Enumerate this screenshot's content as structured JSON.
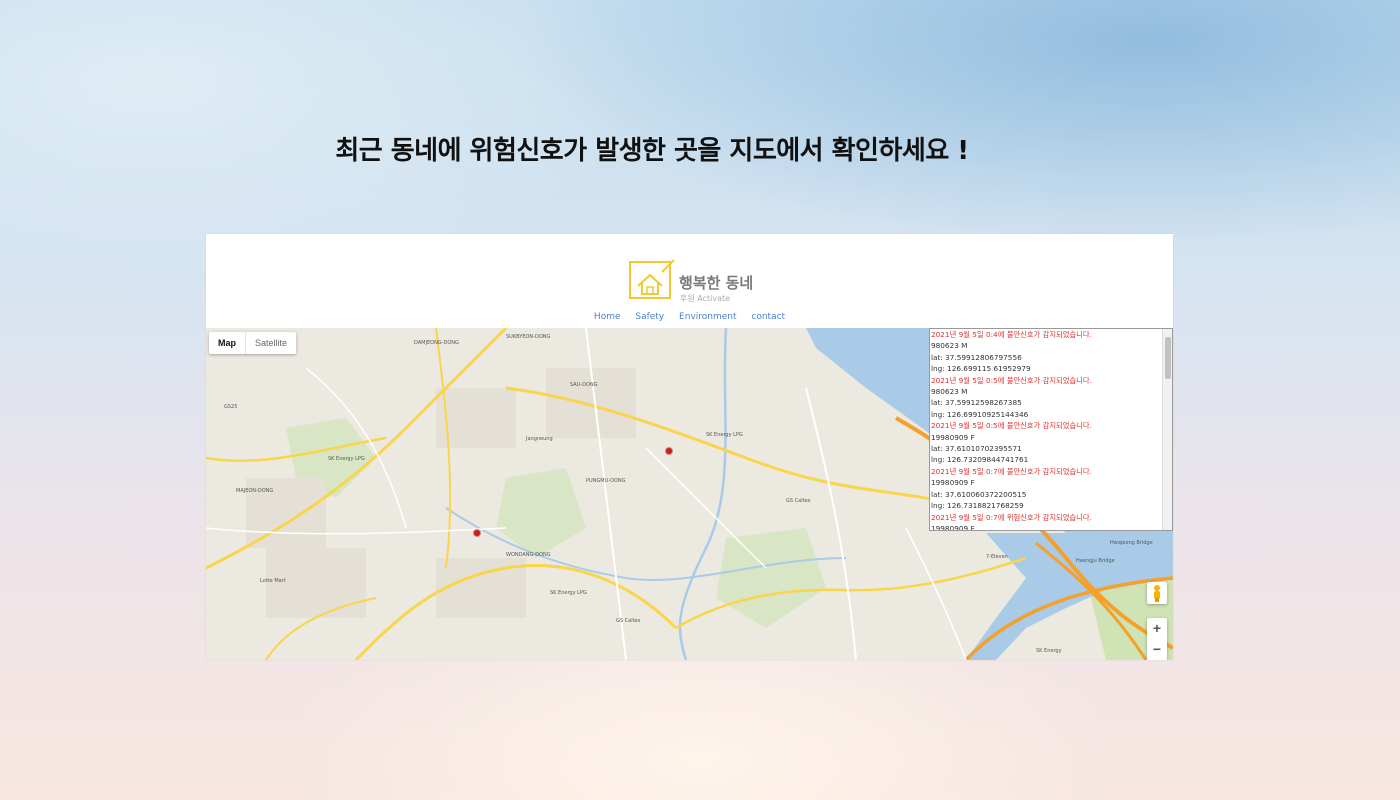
{
  "slide": {
    "title": "최근 동네에 위험신호가 발생한 곳을 지도에서 확인하세요 !"
  },
  "site": {
    "logo_title": "행복한 동네",
    "logo_sub": "후원 Activate",
    "nav": [
      "Home",
      "Safety",
      "Environment",
      "contact"
    ]
  },
  "map": {
    "type_buttons": {
      "map": "Map",
      "satellite": "Satellite"
    },
    "zoom_in": "+",
    "zoom_out": "−",
    "labels": [
      "DAMJEONG-DONG",
      "SUKBYEON-DONG",
      "SAU-DONG",
      "GS25",
      "SK Energy LPG",
      "Jangneung",
      "PUNGMU-DONG",
      "MAJEON-DONG",
      "WONDANG-DONG",
      "Lotte Mart",
      "SK Energy LPG",
      "GS Caltex",
      "SK Energy",
      "SK Energy LPG",
      "GS Caltex",
      "Haengju Bridge",
      "Hwajeong Bridge",
      "7-Eleven"
    ],
    "colors": {
      "land": "#ece9e0",
      "water": "#a9cbe8",
      "highway": "#f5a02a",
      "road": "#f9d54c",
      "park": "#cfe3b5"
    }
  },
  "alerts": [
    {
      "text": "2021년 9월 5일 0:4에 불안신호가 감지되었습니다.",
      "kind": "alert"
    },
    {
      "text": "980623 M",
      "kind": "info"
    },
    {
      "text": "lat: 37.59912806797556",
      "kind": "info"
    },
    {
      "text": "lng: 126.699115 61952979",
      "kind": "info"
    },
    {
      "text": "2021년 9월 5일 0:5에 불안신호가 감지되었습니다.",
      "kind": "alert"
    },
    {
      "text": "980623 M",
      "kind": "info"
    },
    {
      "text": "lat: 37.59912598267385",
      "kind": "info"
    },
    {
      "text": "lng: 126.69910925144346",
      "kind": "info"
    },
    {
      "text": "2021년 9월 5일 0:5에 불안신호가 감지되었습니다.",
      "kind": "alert"
    },
    {
      "text": "19980909 F",
      "kind": "info"
    },
    {
      "text": "lat: 37.61010702395571",
      "kind": "info"
    },
    {
      "text": "lng: 126.73209844741761",
      "kind": "info"
    },
    {
      "text": "2021년 9월 5일 0:7에 불안신호가 감지되었습니다.",
      "kind": "alert"
    },
    {
      "text": "19980909 F",
      "kind": "info"
    },
    {
      "text": "lat: 37.610060372200515",
      "kind": "info"
    },
    {
      "text": "lng: 126.7318821768259",
      "kind": "info"
    },
    {
      "text": "2021년 9월 5일 0:7에 위험신호가 감지되었습니다.",
      "kind": "alert"
    },
    {
      "text": "19980909 F",
      "kind": "info"
    }
  ]
}
